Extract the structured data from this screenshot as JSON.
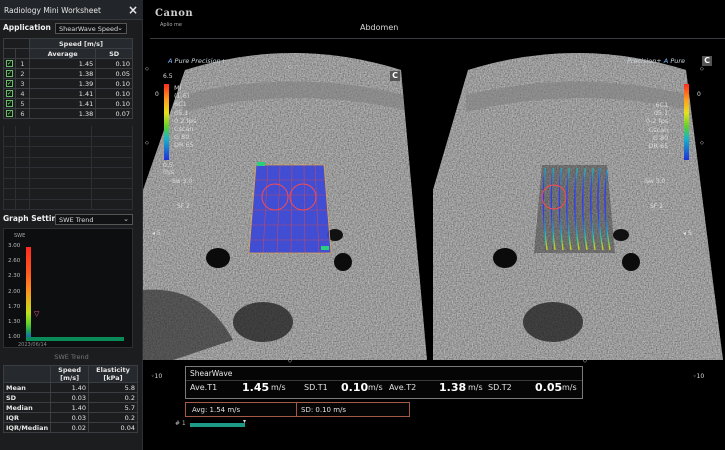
{
  "panel": {
    "title": "Radiology Mini Worksheet",
    "close_label": "×",
    "application_label": "Application",
    "application_value": "ShearWave Speed",
    "speed_header": "Speed [m/s]",
    "col_average": "Average",
    "col_sd": "SD",
    "rows": [
      {
        "idx": "1",
        "avg": "1.45",
        "sd": "0.10"
      },
      {
        "idx": "2",
        "avg": "1.38",
        "sd": "0.05"
      },
      {
        "idx": "3",
        "avg": "1.39",
        "sd": "0.10"
      },
      {
        "idx": "4",
        "avg": "1.41",
        "sd": "0.10"
      },
      {
        "idx": "5",
        "avg": "1.41",
        "sd": "0.10"
      },
      {
        "idx": "6",
        "avg": "1.38",
        "sd": "0.07"
      }
    ],
    "graph_label": "Graph Setting",
    "graph_value": "SWE Trend",
    "trend_header": "SWE",
    "trend_ticks": [
      "3.00",
      "2.60",
      "2.30",
      "2.00",
      "1.70",
      "1.30",
      "1.00"
    ],
    "trend_date": "2023/06/14",
    "swe_trend_title": "SWE Trend",
    "stats_headers": [
      "",
      "Speed [m/s]",
      "Elasticity [kPa]"
    ],
    "stats": [
      {
        "k": "Mean",
        "speed": "1.40",
        "elast": "5.8"
      },
      {
        "k": "SD",
        "speed": "0.03",
        "elast": "0.2"
      },
      {
        "k": "Median",
        "speed": "1.40",
        "elast": "5.7"
      },
      {
        "k": "IQR",
        "speed": "0.03",
        "elast": "0.2"
      },
      {
        "k": "IQR/Median",
        "speed": "0.02",
        "elast": "0.04"
      }
    ]
  },
  "header": {
    "brand": "Canon",
    "model": "Aplio me",
    "exam": "Abdomen"
  },
  "left_image": {
    "precision_a": "A",
    "precision_text": "Pure Precision+",
    "badge": "C",
    "scale_top": "6.5",
    "scale_zero": "0",
    "scale_bottom": "0.5",
    "scale_unit": "m/s",
    "params": [
      "MI",
      "(1.6)",
      "6C1",
      "d5.1",
      "0.2 fps",
      "Cscan",
      "G 80",
      "DR 65"
    ],
    "sw": "Sw 3.0",
    "sf": "SF 2",
    "depth5": "5",
    "depth10": "10"
  },
  "right_image": {
    "precision_text": "Precision+",
    "precision_a": "A",
    "precision_pure": "Pure",
    "badge": "C",
    "scale_zero": "0",
    "params": [
      "6C1",
      "d5.1",
      "0.2 fps",
      "Cscan",
      "G 80",
      "DR 65"
    ],
    "sw": "Sw 3.0",
    "sf": "SF 2",
    "depth5": "5",
    "depth10": "10"
  },
  "shearwave": {
    "title": "ShearWave",
    "ave_t1_label": "Ave.T1",
    "ave_t1_value": "1.45",
    "sd_t1_label": "SD.T1",
    "sd_t1_value": "0.10",
    "ave_t2_label": "Ave.T2",
    "ave_t2_value": "1.38",
    "sd_t2_label": "SD.T2",
    "sd_t2_value": "0.05",
    "unit": "m/s"
  },
  "summary": {
    "avg_text": "Avg:  1.54 m/s",
    "sd_text": "SD:  0.10 m/s"
  },
  "clip": {
    "number": "# 1"
  }
}
